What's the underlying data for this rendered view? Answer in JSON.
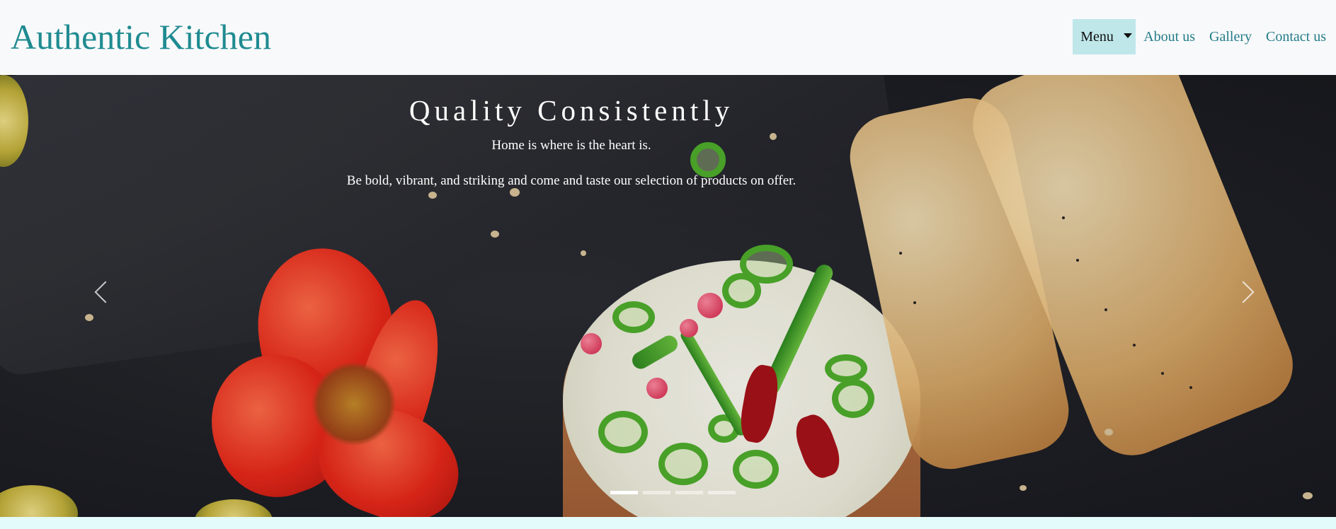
{
  "navbar": {
    "brand": "Authentic Kitchen",
    "items": [
      {
        "label": "Menu",
        "dropdown": true,
        "active": true
      },
      {
        "label": "About us"
      },
      {
        "label": "Gallery"
      },
      {
        "label": "Contact us"
      }
    ]
  },
  "carousel": {
    "title": "Quality Consistently",
    "subtitle": "Home is where is the heart is.",
    "description": "Be bold, vibrant, and striking and come and taste our selection of products on offer.",
    "slide_count": 4,
    "active_slide": 1,
    "prev_icon": "chevron-left-icon",
    "next_icon": "chevron-right-icon"
  },
  "colors": {
    "brand": "#1f8b91",
    "nav_link": "#237c88",
    "menu_active_bg": "#bfe7ea",
    "page_bg": "#e4fbfb"
  }
}
